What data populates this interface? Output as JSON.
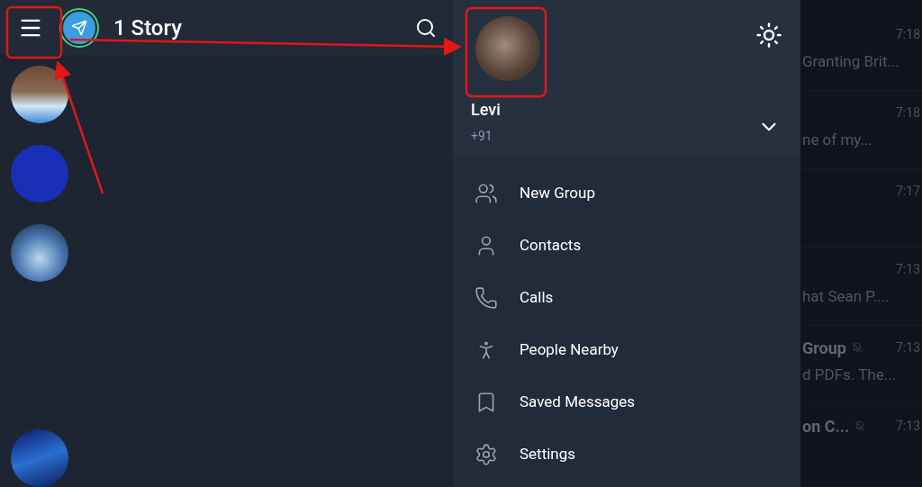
{
  "top_bar": {
    "title": "1 Story"
  },
  "chat_avatars": [
    {
      "kind": "landscape"
    },
    {
      "kind": "blue"
    },
    {
      "kind": "sky"
    },
    {
      "kind": "night"
    }
  ],
  "drawer": {
    "account": {
      "name": "Levi",
      "phone": "+91"
    },
    "menu": [
      {
        "label": "New Group",
        "kind": "group"
      },
      {
        "label": "Contacts",
        "kind": "contact"
      },
      {
        "label": "Calls",
        "kind": "call"
      },
      {
        "label": "People Nearby",
        "kind": "nearby"
      },
      {
        "label": "Saved Messages",
        "kind": "saved"
      },
      {
        "label": "Settings",
        "kind": "settings"
      }
    ]
  },
  "background_chats": [
    {
      "preview": "Granting Brit...",
      "time": "7:18",
      "muted": false
    },
    {
      "preview": "ne of my...",
      "time": "7:18",
      "muted": false
    },
    {
      "time": "7:17",
      "muted": false
    },
    {
      "preview": "hat Sean P....",
      "time": "7:13",
      "muted": false
    },
    {
      "name": "Group",
      "preview": "d PDFs. The...",
      "time": "7:13",
      "muted": true
    },
    {
      "name": "on C...",
      "time": "7:13",
      "muted": true
    }
  ]
}
